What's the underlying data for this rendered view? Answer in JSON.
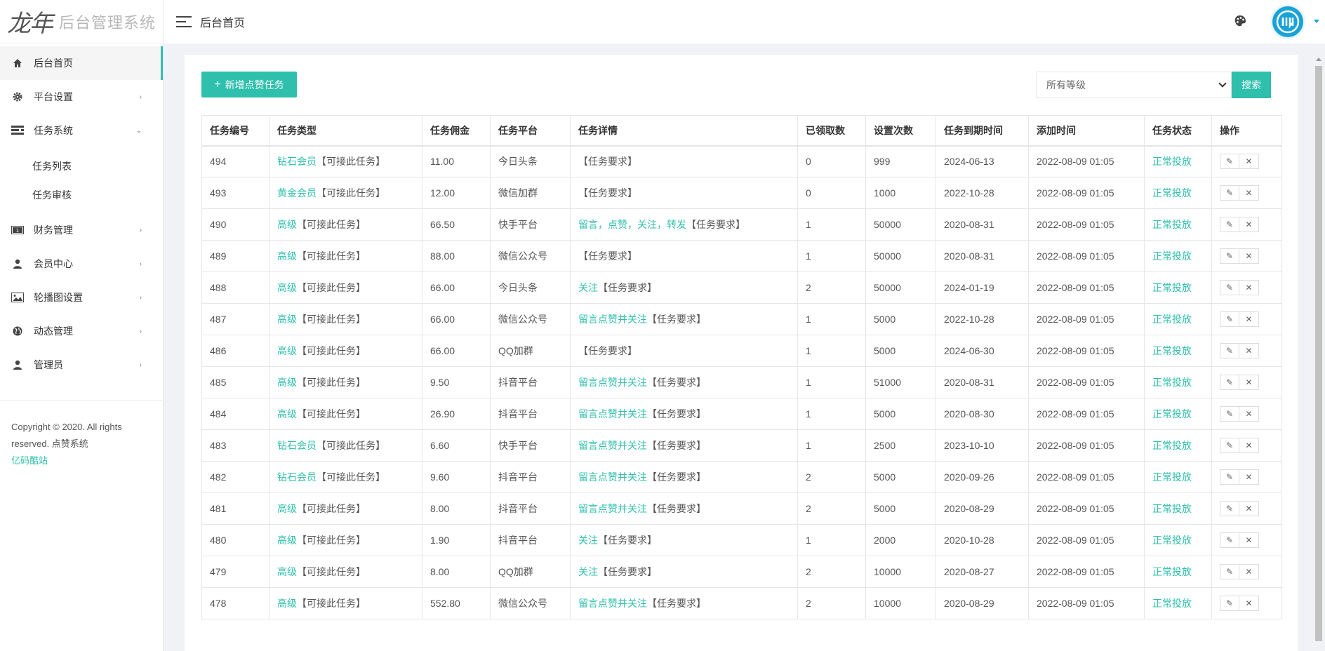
{
  "brand": {
    "mark": "龙年",
    "title": "后台管理系统"
  },
  "header": {
    "title": "后台首页"
  },
  "sidebar": {
    "items": [
      {
        "label": "后台首页",
        "icon": "home-icon",
        "active": true,
        "arrow": ""
      },
      {
        "label": "平台设置",
        "icon": "gear-icon",
        "arrow": "›"
      },
      {
        "label": "任务系统",
        "icon": "list-icon",
        "arrow": "⌄"
      },
      {
        "label": "财务管理",
        "icon": "money-icon",
        "arrow": "›"
      },
      {
        "label": "会员中心",
        "icon": "user-icon",
        "arrow": "›"
      },
      {
        "label": "轮播图设置",
        "icon": "image-icon",
        "arrow": "›"
      },
      {
        "label": "动态管理",
        "icon": "globe-icon",
        "arrow": "›"
      },
      {
        "label": "管理员",
        "icon": "admin-icon",
        "arrow": "›"
      }
    ],
    "sub_items": [
      "任务列表",
      "任务审核"
    ]
  },
  "copyright": {
    "text": "Copyright © 2020. All rights reserved. 点赞系统",
    "link": "亿码酷站"
  },
  "toolbar": {
    "add_label": "新增点赞任务",
    "select_value": "所有等级",
    "search_label": "搜索"
  },
  "table": {
    "headers": [
      "任务编号",
      "任务类型",
      "任务佣金",
      "任务平台",
      "任务详情",
      "已领取数",
      "设置次数",
      "任务到期时间",
      "添加时间",
      "任务状态",
      "操作"
    ],
    "rows": [
      {
        "id": "494",
        "level": "钻石会员",
        "type_suffix": "【可接此任务】",
        "commission": "11.00",
        "platform": "今日头条",
        "detail_green": "",
        "detail_suffix": "【任务要求】",
        "claimed": "0",
        "times": "999",
        "expire": "2024-06-13",
        "added": "2022-08-09 01:05",
        "status": "正常投放"
      },
      {
        "id": "493",
        "level": "黄金会员",
        "type_suffix": "【可接此任务】",
        "commission": "12.00",
        "platform": "微信加群",
        "detail_green": "",
        "detail_suffix": "【任务要求】",
        "claimed": "0",
        "times": "1000",
        "expire": "2022-10-28",
        "added": "2022-08-09 01:05",
        "status": "正常投放"
      },
      {
        "id": "490",
        "level": "高级",
        "type_suffix": "【可接此任务】",
        "commission": "66.50",
        "platform": "快手平台",
        "detail_green": "留言，点赞，关注，转发",
        "detail_suffix": "【任务要求】",
        "claimed": "1",
        "times": "50000",
        "expire": "2020-08-31",
        "added": "2022-08-09 01:05",
        "status": "正常投放"
      },
      {
        "id": "489",
        "level": "高级",
        "type_suffix": "【可接此任务】",
        "commission": "88.00",
        "platform": "微信公众号",
        "detail_green": "",
        "detail_suffix": "【任务要求】",
        "claimed": "1",
        "times": "50000",
        "expire": "2020-08-31",
        "added": "2022-08-09 01:05",
        "status": "正常投放"
      },
      {
        "id": "488",
        "level": "高级",
        "type_suffix": "【可接此任务】",
        "commission": "66.00",
        "platform": "今日头条",
        "detail_green": "关注",
        "detail_suffix": "【任务要求】",
        "claimed": "2",
        "times": "50000",
        "expire": "2024-01-19",
        "added": "2022-08-09 01:05",
        "status": "正常投放"
      },
      {
        "id": "487",
        "level": "高级",
        "type_suffix": "【可接此任务】",
        "commission": "66.00",
        "platform": "微信公众号",
        "detail_green": "留言点赞并关注",
        "detail_suffix": "【任务要求】",
        "claimed": "1",
        "times": "5000",
        "expire": "2022-10-28",
        "added": "2022-08-09 01:05",
        "status": "正常投放"
      },
      {
        "id": "486",
        "level": "高级",
        "type_suffix": "【可接此任务】",
        "commission": "66.00",
        "platform": "QQ加群",
        "detail_green": "",
        "detail_suffix": "【任务要求】",
        "claimed": "1",
        "times": "5000",
        "expire": "2024-06-30",
        "added": "2022-08-09 01:05",
        "status": "正常投放"
      },
      {
        "id": "485",
        "level": "高级",
        "type_suffix": "【可接此任务】",
        "commission": "9.50",
        "platform": "抖音平台",
        "detail_green": "留言点赞并关注",
        "detail_suffix": "【任务要求】",
        "claimed": "1",
        "times": "51000",
        "expire": "2020-08-31",
        "added": "2022-08-09 01:05",
        "status": "正常投放"
      },
      {
        "id": "484",
        "level": "高级",
        "type_suffix": "【可接此任务】",
        "commission": "26.90",
        "platform": "抖音平台",
        "detail_green": "留言点赞并关注",
        "detail_suffix": "【任务要求】",
        "claimed": "1",
        "times": "5000",
        "expire": "2020-08-30",
        "added": "2022-08-09 01:05",
        "status": "正常投放"
      },
      {
        "id": "483",
        "level": "钻石会员",
        "type_suffix": "【可接此任务】",
        "commission": "6.60",
        "platform": "快手平台",
        "detail_green": "留言点赞并关注",
        "detail_suffix": "【任务要求】",
        "claimed": "1",
        "times": "2500",
        "expire": "2023-10-10",
        "added": "2022-08-09 01:05",
        "status": "正常投放"
      },
      {
        "id": "482",
        "level": "钻石会员",
        "type_suffix": "【可接此任务】",
        "commission": "9.60",
        "platform": "抖音平台",
        "detail_green": "留言点赞并关注",
        "detail_suffix": "【任务要求】",
        "claimed": "2",
        "times": "5000",
        "expire": "2020-09-26",
        "added": "2022-08-09 01:05",
        "status": "正常投放"
      },
      {
        "id": "481",
        "level": "高级",
        "type_suffix": "【可接此任务】",
        "commission": "8.00",
        "platform": "抖音平台",
        "detail_green": "留言点赞并关注",
        "detail_suffix": "【任务要求】",
        "claimed": "2",
        "times": "5000",
        "expire": "2020-08-29",
        "added": "2022-08-09 01:05",
        "status": "正常投放"
      },
      {
        "id": "480",
        "level": "高级",
        "type_suffix": "【可接此任务】",
        "commission": "1.90",
        "platform": "抖音平台",
        "detail_green": "关注",
        "detail_suffix": "【任务要求】",
        "claimed": "1",
        "times": "2000",
        "expire": "2020-10-28",
        "added": "2022-08-09 01:05",
        "status": "正常投放"
      },
      {
        "id": "479",
        "level": "高级",
        "type_suffix": "【可接此任务】",
        "commission": "8.00",
        "platform": "QQ加群",
        "detail_green": "关注",
        "detail_suffix": "【任务要求】",
        "claimed": "2",
        "times": "10000",
        "expire": "2020-08-27",
        "added": "2022-08-09 01:05",
        "status": "正常投放"
      },
      {
        "id": "478",
        "level": "高级",
        "type_suffix": "【可接此任务】",
        "commission": "552.80",
        "platform": "微信公众号",
        "detail_green": "留言点赞并关注",
        "detail_suffix": "【任务要求】",
        "claimed": "2",
        "times": "10000",
        "expire": "2020-08-29",
        "added": "2022-08-09 01:05",
        "status": "正常投放"
      }
    ]
  },
  "colors": {
    "accent": "#2fbfad",
    "avatar": "#1aa3d8"
  }
}
